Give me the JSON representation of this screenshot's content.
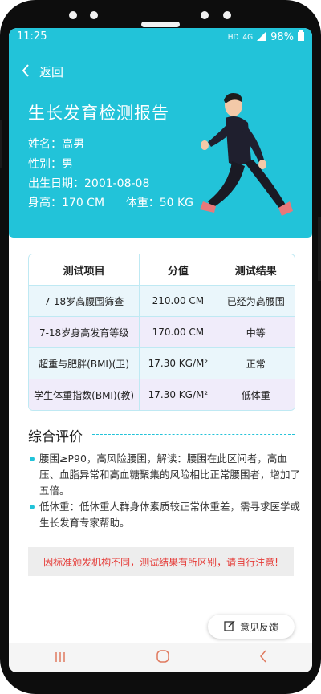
{
  "status": {
    "time": "11:25",
    "battery": "98%",
    "net": "4G",
    "hd": "HD"
  },
  "header": {
    "back_label": "返回",
    "title": "生长发育检测报告",
    "name": "姓名：高男",
    "gender": "性别：男",
    "birth": "出生日期：2001-08-08",
    "height_weight": "身高：170 CM      体重：50 KG"
  },
  "table": {
    "headers": [
      "测试项目",
      "分值",
      "测试结果"
    ],
    "rows": [
      [
        "7-18岁高腰围筛查",
        "210.00 CM",
        "已经为高腰围"
      ],
      [
        "7-18岁身高发育等级",
        "170.00 CM",
        "中等"
      ],
      [
        "超重与肥胖(BMI)(卫)",
        "17.30 KG/M²",
        "正常"
      ],
      [
        "学生体重指数(BMI)(教)",
        "17.30 KG/M²",
        "低体重"
      ]
    ]
  },
  "evaluation": {
    "title": "综合评价",
    "items": [
      "腰围≥P90，高风险腰围，解读：腰围在此区间者，高血压、血脂异常和高血糖聚集的风险相比正常腰围者，增加了五倍。",
      "低体重：低体重人群身体素质较正常体重差，需寻求医学或生长发育专家帮助。"
    ]
  },
  "notice": "因标准颁发机构不同，测试结果有所区别，请自行注意!",
  "feedback_label": "意见反馈",
  "colors": {
    "accent": "#22c3d9",
    "notice_text": "#e53935"
  }
}
